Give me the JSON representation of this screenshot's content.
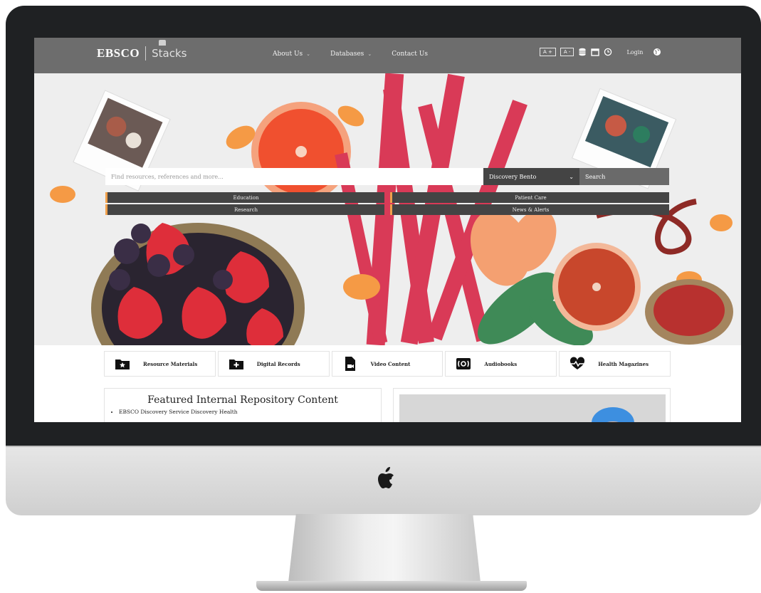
{
  "brand": {
    "name": "EBSCO",
    "product": "Stacks"
  },
  "nav": {
    "items": [
      {
        "label": "About Us",
        "has_dropdown": true
      },
      {
        "label": "Databases",
        "has_dropdown": true
      },
      {
        "label": "Contact Us",
        "has_dropdown": false
      }
    ],
    "font_increase": "A +",
    "font_decrease": "A -",
    "tools": [
      "database-icon",
      "calendar-icon",
      "clock-icon"
    ],
    "login": "Login",
    "language_icon": "globe-icon"
  },
  "search": {
    "placeholder": "Find resources, references and more...",
    "scope": "Discovery Bento",
    "button": "Search"
  },
  "quick_links": [
    "Education",
    "Patient Care",
    "Research",
    "News & Alerts"
  ],
  "categories": [
    {
      "label": "Resource Materials",
      "icon": "folder-star-icon"
    },
    {
      "label": "Digital Records",
      "icon": "folder-plus-icon"
    },
    {
      "label": "Video Content",
      "icon": "file-video-icon"
    },
    {
      "label": "Audiobooks",
      "icon": "audio-icon"
    },
    {
      "label": "Health Magazines",
      "icon": "heart-pulse-icon"
    }
  ],
  "featured": {
    "title": "Featured Internal Repository Content",
    "items": [
      "EBSCO Discovery Service Discovery Health"
    ]
  },
  "colors": {
    "nav_bg": "#6d6d6d",
    "dark_button": "#444444",
    "accent_orange": "#f0a04b"
  }
}
